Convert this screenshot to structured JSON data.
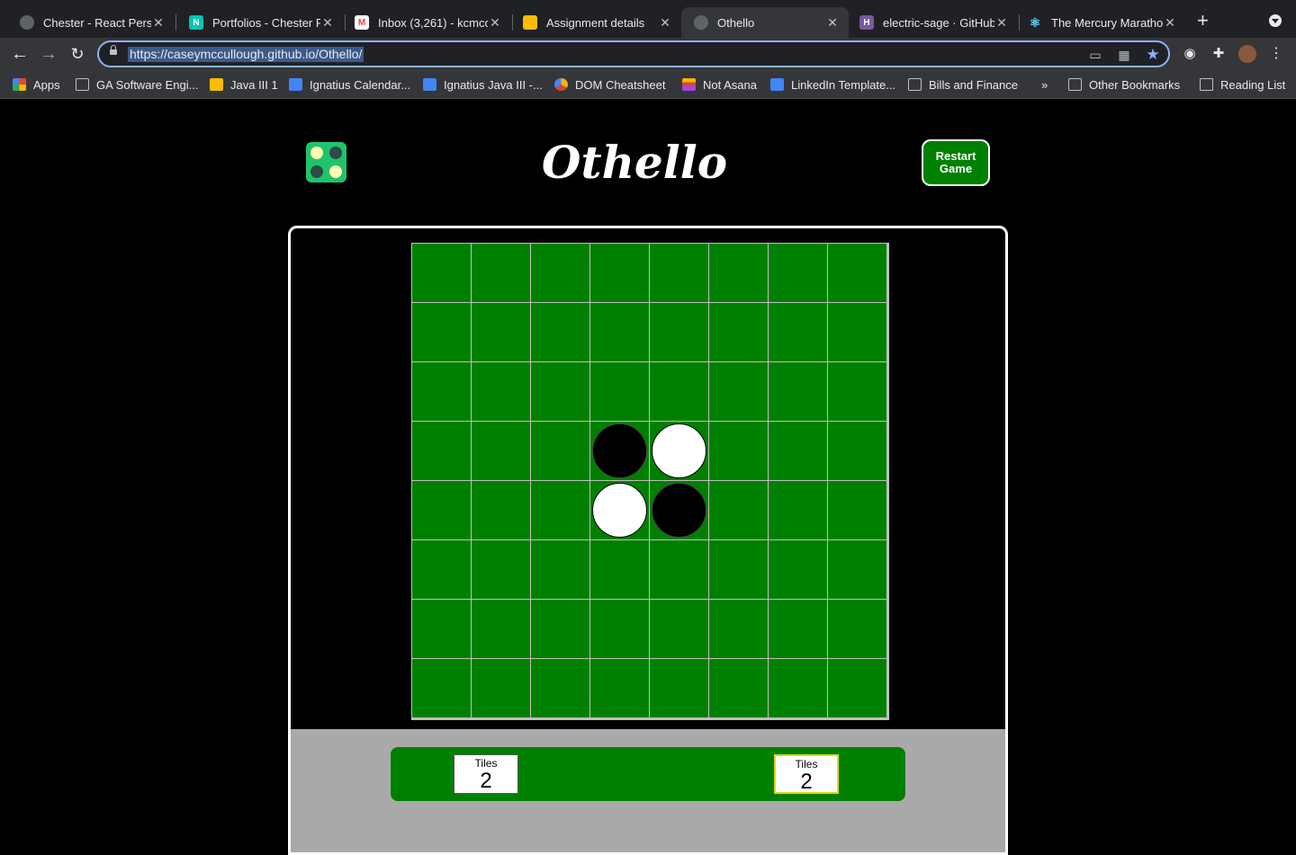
{
  "browser": {
    "tabs": [
      {
        "title": "Chester - React Perso",
        "active": false,
        "favicon": "globe-icon"
      },
      {
        "title": "Portfolios - Chester R",
        "active": false,
        "favicon": "netlify-icon"
      },
      {
        "title": "Inbox (3,261) - kcmcc",
        "active": false,
        "favicon": "gmail-icon"
      },
      {
        "title": "Assignment details",
        "active": false,
        "favicon": "classroom-icon"
      },
      {
        "title": "Othello",
        "active": true,
        "favicon": "globe-icon"
      },
      {
        "title": "electric-sage · GitHub",
        "active": false,
        "favicon": "heroku-icon"
      },
      {
        "title": "The Mercury Maratho",
        "active": false,
        "favicon": "react-icon"
      }
    ],
    "url": "https://caseymccullough.github.io/Othello/",
    "bookmarks": [
      {
        "label": "Apps",
        "icon": "apps-grid-icon"
      },
      {
        "label": "GA Software Engi...",
        "icon": "folder-icon"
      },
      {
        "label": "Java III 1",
        "icon": "classroom-icon"
      },
      {
        "label": "Ignatius Calendar...",
        "icon": "doc-icon"
      },
      {
        "label": "Ignatius Java III -...",
        "icon": "doc-icon"
      },
      {
        "label": "DOM Cheatsheet",
        "icon": "pinwheel-icon"
      },
      {
        "label": "Not Asana",
        "icon": "rainbow-icon"
      },
      {
        "label": "LinkedIn Template...",
        "icon": "doc-icon"
      },
      {
        "label": "Bills and Finance",
        "icon": "folder-icon"
      }
    ],
    "bookmarks_overflow": "»",
    "other_bookmarks": "Other Bookmarks",
    "reading_list": "Reading List"
  },
  "game": {
    "title": "Othello",
    "restart_label_line1": "Restart",
    "restart_label_line2": "Game",
    "board_size": 8,
    "discs": [
      {
        "row": 3,
        "col": 3,
        "color": "black"
      },
      {
        "row": 3,
        "col": 4,
        "color": "white"
      },
      {
        "row": 4,
        "col": 3,
        "color": "white"
      },
      {
        "row": 4,
        "col": 4,
        "color": "black"
      }
    ],
    "scores": [
      {
        "label": "Tiles",
        "value": "2"
      },
      {
        "label": "Tiles",
        "value": "2"
      }
    ],
    "colors": {
      "board": "#008000",
      "logo": "#1fc46a",
      "active_player_outline": "#e8d21a"
    }
  }
}
